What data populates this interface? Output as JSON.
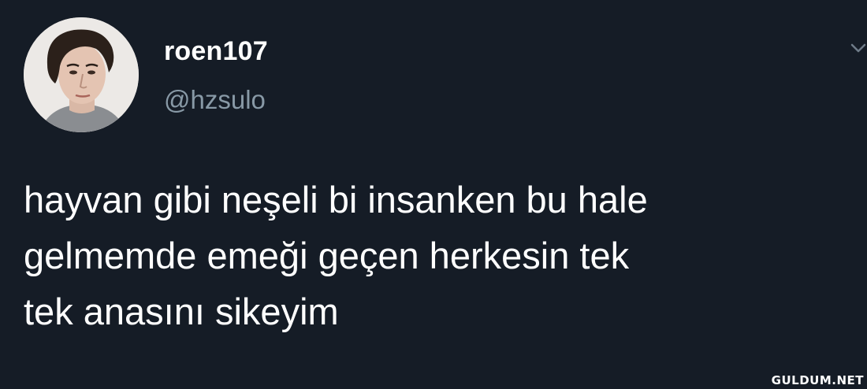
{
  "tweet": {
    "author": {
      "display_name": "roen107",
      "handle": "@hzsulo",
      "avatar_icon": "profile-photo"
    },
    "menu_icon": "chevron-down-icon",
    "text_lines": [
      "hayvan gibi neşeli bi insanken bu hale",
      "gelmemde emeği geçen herkesin tek",
      "tek anasını sikeyim"
    ]
  },
  "watermark": "GULDUM.NET",
  "colors": {
    "background": "#151c26",
    "text": "#ffffff",
    "handle": "#8899a6"
  }
}
